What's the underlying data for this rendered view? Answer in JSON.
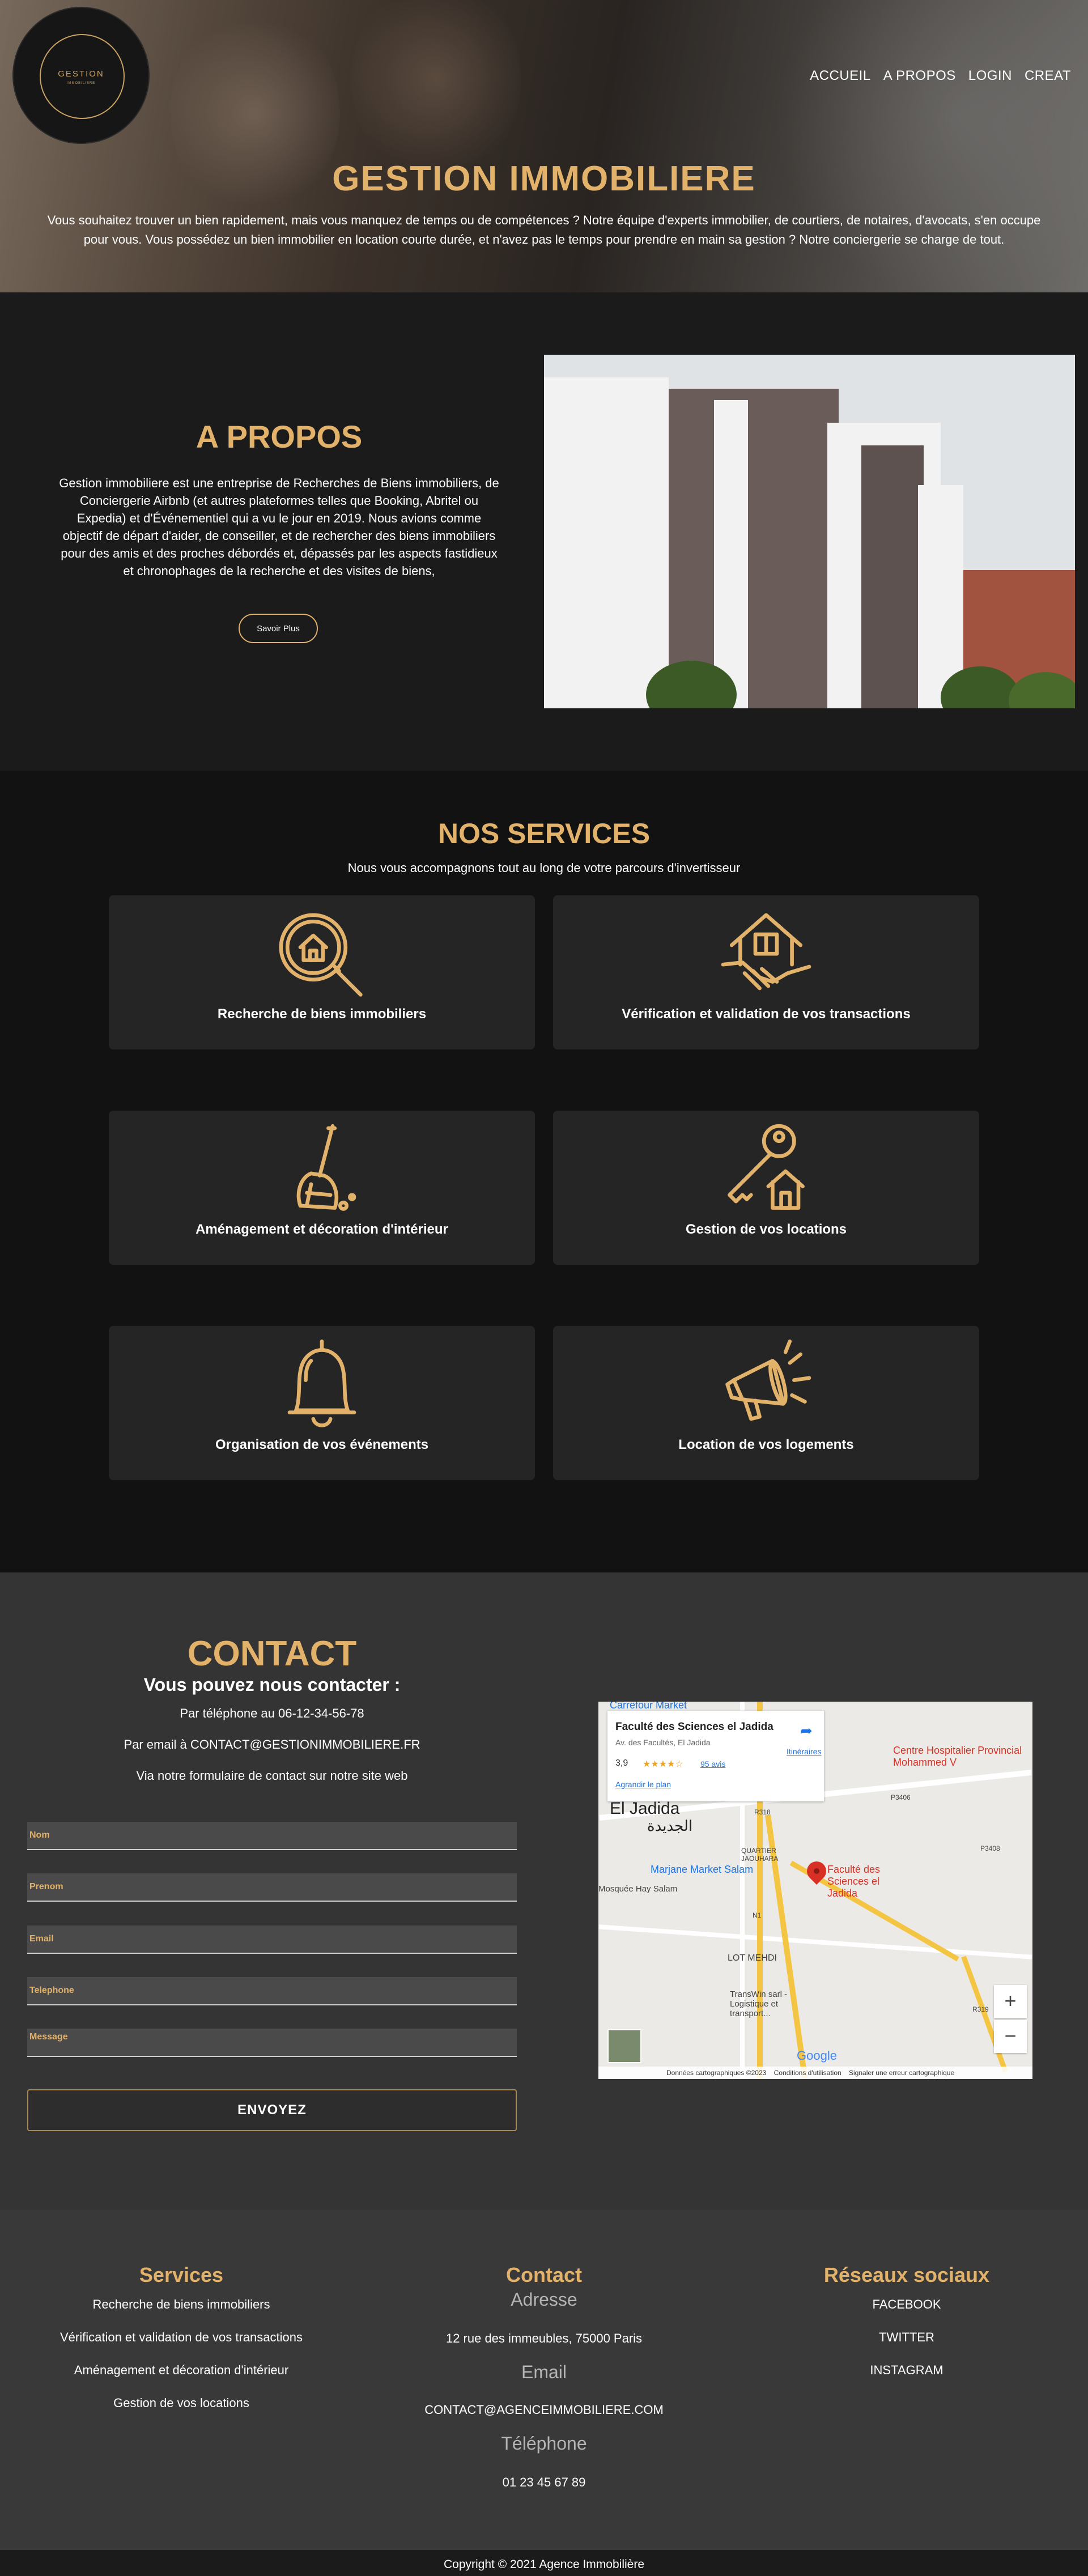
{
  "colors": {
    "accent": "#e3b26a",
    "dark": "#121212",
    "card": "#252525",
    "contact_bg": "#343434",
    "footer_bg": "#393939"
  },
  "logo": {
    "text": "GESTION",
    "subtext": "IMMOBILIERE"
  },
  "nav": {
    "items": [
      "ACCUEIL",
      "A PROPOS",
      "LOGIN",
      "CREAT"
    ]
  },
  "hero": {
    "title": "GESTION IMMOBILIERE",
    "text": "Vous souhaitez trouver un bien rapidement, mais vous manquez de temps ou de compétences ? Notre équipe d'experts immobilier, de courtiers, de notaires, d'avocats, s'en occupe pour vous. Vous possédez un bien immobilier en location courte durée, et n'avez pas le temps pour prendre en main sa gestion ? Notre conciergerie se charge de tout."
  },
  "about": {
    "title": "A PROPOS",
    "text": "Gestion immobiliere est une entreprise de Recherches de Biens immobiliers, de Conciergerie Airbnb (et autres plateformes telles que Booking, Abritel ou Expedia) et d'Événementiel qui a vu le jour en 2019. Nous avions comme objectif de départ d'aider, de conseiller, et de rechercher des biens immobiliers pour des amis et des proches débordés et, dépassés par les aspects fastidieux et chronophages de la recherche et des visites de biens,",
    "button": "Savoir Plus"
  },
  "services": {
    "title": "NOS SERVICES",
    "subtitle": "Nous vous accompagnons tout au long de votre parcours d'invertisseur",
    "items": [
      {
        "label": "Recherche de biens immobiliers",
        "icon": "house-search-icon"
      },
      {
        "label": "Vérification et validation de vos transactions",
        "icon": "handshake-house-icon"
      },
      {
        "label": "Aménagement et décoration d'intérieur",
        "icon": "broom-icon"
      },
      {
        "label": "Gestion de vos locations",
        "icon": "house-key-icon"
      },
      {
        "label": "Organisation de vos événements",
        "icon": "bell-icon"
      },
      {
        "label": "Location de vos logements",
        "icon": "megaphone-icon"
      }
    ]
  },
  "contact": {
    "title": "CONTACT",
    "subtitle": "Vous pouvez nous contacter :",
    "phone_line": "Par téléphone au 06-12-34-56-78",
    "email_line": "Par email à CONTACT@GESTIONIMMOBILIERE.FR",
    "form_line": "Via notre formulaire de contact sur notre site web",
    "fields": {
      "nom": "Nom",
      "prenom": "Prenom",
      "email": "Email",
      "telephone": "Telephone",
      "message": "Message"
    },
    "submit": "ENVOYEZ"
  },
  "map": {
    "place": "Faculté des Sciences el Jadida",
    "address": "Av. des Facultés, El Jadida",
    "rating": "3,9",
    "stars": "★★★★☆",
    "reviews": "95 avis",
    "enlarge": "Agrandir le plan",
    "directions": "Itinéraires",
    "labels": {
      "carrefour": "Carrefour Market",
      "hospital": "Centre Hospitalier Provincial Mohammed V",
      "city": "El Jadida",
      "city_ar": "الجديدة",
      "marjane": "Marjane Market Salam",
      "mosque": "Mosquée Hay Salam",
      "faculty": "Faculté des Sciences el Jadida",
      "quartier": "QUARTIER JAOUHARA",
      "lot": "LOT MEHDI",
      "transwin": "TransWin sarl - Logistique et transport...",
      "r318": "R318",
      "p3406": "P3406",
      "p3408": "P3408",
      "n1": "N1",
      "r319": "R319"
    },
    "footer": [
      "Données cartographiques ©2023",
      "Conditions d'utilisation",
      "Signaler une erreur cartographique"
    ],
    "google": "Google"
  },
  "footer": {
    "services": {
      "title": "Services",
      "items": [
        "Recherche de biens immobiliers",
        "Vérification et validation de vos transactions",
        "Aménagement et décoration d'intérieur",
        "Gestion de vos locations"
      ]
    },
    "contact": {
      "title": "Contact",
      "address_label": "Adresse",
      "address": "12 rue des immeubles, 75000 Paris",
      "email_label": "Email",
      "email": "CONTACT@AGENCEIMMOBILIERE.COM",
      "phone_label": "Téléphone",
      "phone": "01 23 45 67 89"
    },
    "social": {
      "title": "Réseaux sociaux",
      "items": [
        "FACEBOOK",
        "TWITTER",
        "INSTAGRAM"
      ]
    },
    "copyright": "Copyright © 2021 Agence Immobilière"
  }
}
